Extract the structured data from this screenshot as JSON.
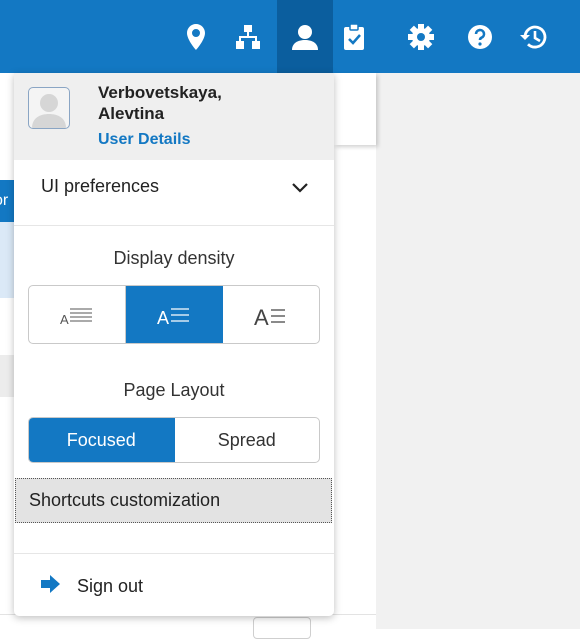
{
  "topbar": {
    "icons": [
      "location-pin-icon",
      "org-chart-icon",
      "user-icon",
      "clipboard-check-icon",
      "gear-icon",
      "help-icon",
      "history-icon"
    ],
    "active_icon": "user-icon",
    "color": "#1378c3",
    "active_color": "#0b5e9e"
  },
  "background": {
    "tab_fragment": "or"
  },
  "user": {
    "name_line1": "Verbovetskaya,",
    "name_line2": "Alevtina",
    "details_link": "User Details"
  },
  "prefs": {
    "label": "UI preferences",
    "expanded": true
  },
  "density": {
    "title": "Display density",
    "options": [
      "compact-density-icon",
      "normal-density-icon",
      "comfortable-density-icon"
    ],
    "selected": 1
  },
  "layout": {
    "title": "Page Layout",
    "options": [
      "Focused",
      "Spread"
    ],
    "selected": 0
  },
  "menu": {
    "shortcuts": "Shortcuts customization",
    "signout": "Sign out"
  }
}
